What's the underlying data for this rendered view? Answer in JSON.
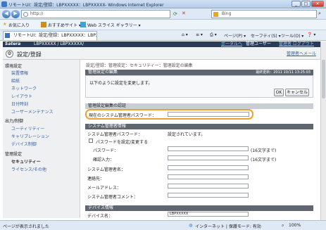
{
  "window": {
    "title": "リモートUI：設定/登録：LBPXXXXX：LBPXXXXX- Windows Internet Explorer",
    "minimize": "_",
    "maximize": "□",
    "close": "✕"
  },
  "browser": {
    "address": "http://",
    "search_engine": "Bing",
    "favorites_label": "お気に入り",
    "suggested_sites": "おすすめサイト ▾",
    "web_slice": "Web スライス ギャラリー ▾",
    "tab_title": "リモートUI：設定/登録：LBPXXXXX：LBPXX...",
    "toolbar": {
      "page": "ページ(P) ▾",
      "safety": "セーフティ(S) ▾",
      "tools": "ツール(O) ▾",
      "help": "❓ ▾"
    }
  },
  "header": {
    "brand": "Satera",
    "model": "LBPXXXXX / LBPXXXXX/",
    "portal_link": "ポータルへ",
    "admin_user": "管理ユーザー",
    "logout": "管理者 ログアウト",
    "mail_link": "管理者へメール"
  },
  "page_title": "設定/登録",
  "sidebar": {
    "sections": [
      {
        "title": "環境設定",
        "items": [
          "装置情報",
          "給紙",
          "ネットワーク",
          "レイアウト",
          "日付時刻",
          "ユーザーメンテナンス"
        ]
      },
      {
        "title": "出力/制御",
        "items": [
          "ユーティリティー",
          "キャリブレーション",
          "デバイス制御"
        ]
      },
      {
        "title": "管理設定",
        "items": [
          "セキュリティー",
          "ライセンス/その他"
        ]
      }
    ],
    "selected": "セキュリティー"
  },
  "main": {
    "breadcrumb": "設定/登録：管理設定：セキュリティー：管理設定の編集",
    "edit_header": "管理設定の編集",
    "last_updated": "最終更新：2011 10/11 13:25:03",
    "instruction": "以下のように設定を変更します。",
    "ok_button": "OK",
    "cancel_button": "キャンセル",
    "auth_header": "管理設定編集の認証",
    "current_password_label": "現在のシステム管理者パスワード：",
    "current_password_value": "",
    "sysadmin_header": "システム管理者情報",
    "sysadmin_password_label": "システム管理者パスワード：",
    "sysadmin_password_status": "設定されています。",
    "set_change_password_label": "パスワードを設定/変更する",
    "password_label": "パスワード：",
    "password_note": "(16文字まで)",
    "confirm_label": "確認入力：",
    "confirm_note": "(16文字まで)",
    "sysadmin_name_label": "システム管理者名：",
    "contact_label": "連絡先：",
    "email_label": "メールアドレス：",
    "comment_label": "システム管理者コメント：",
    "device_header": "デバイス情報",
    "device_name_label": "デバイス名：",
    "device_name_value": "LBPXXXXX"
  },
  "status": {
    "left": "ページが表示されました",
    "zone": "インターネット | 保護モード: 有効",
    "zoom": "100%"
  },
  "colors": {
    "header_bg": "#2b3a57",
    "section_bar": "#5f6670",
    "highlight": "#f0a030",
    "link": "#3a61a6"
  }
}
